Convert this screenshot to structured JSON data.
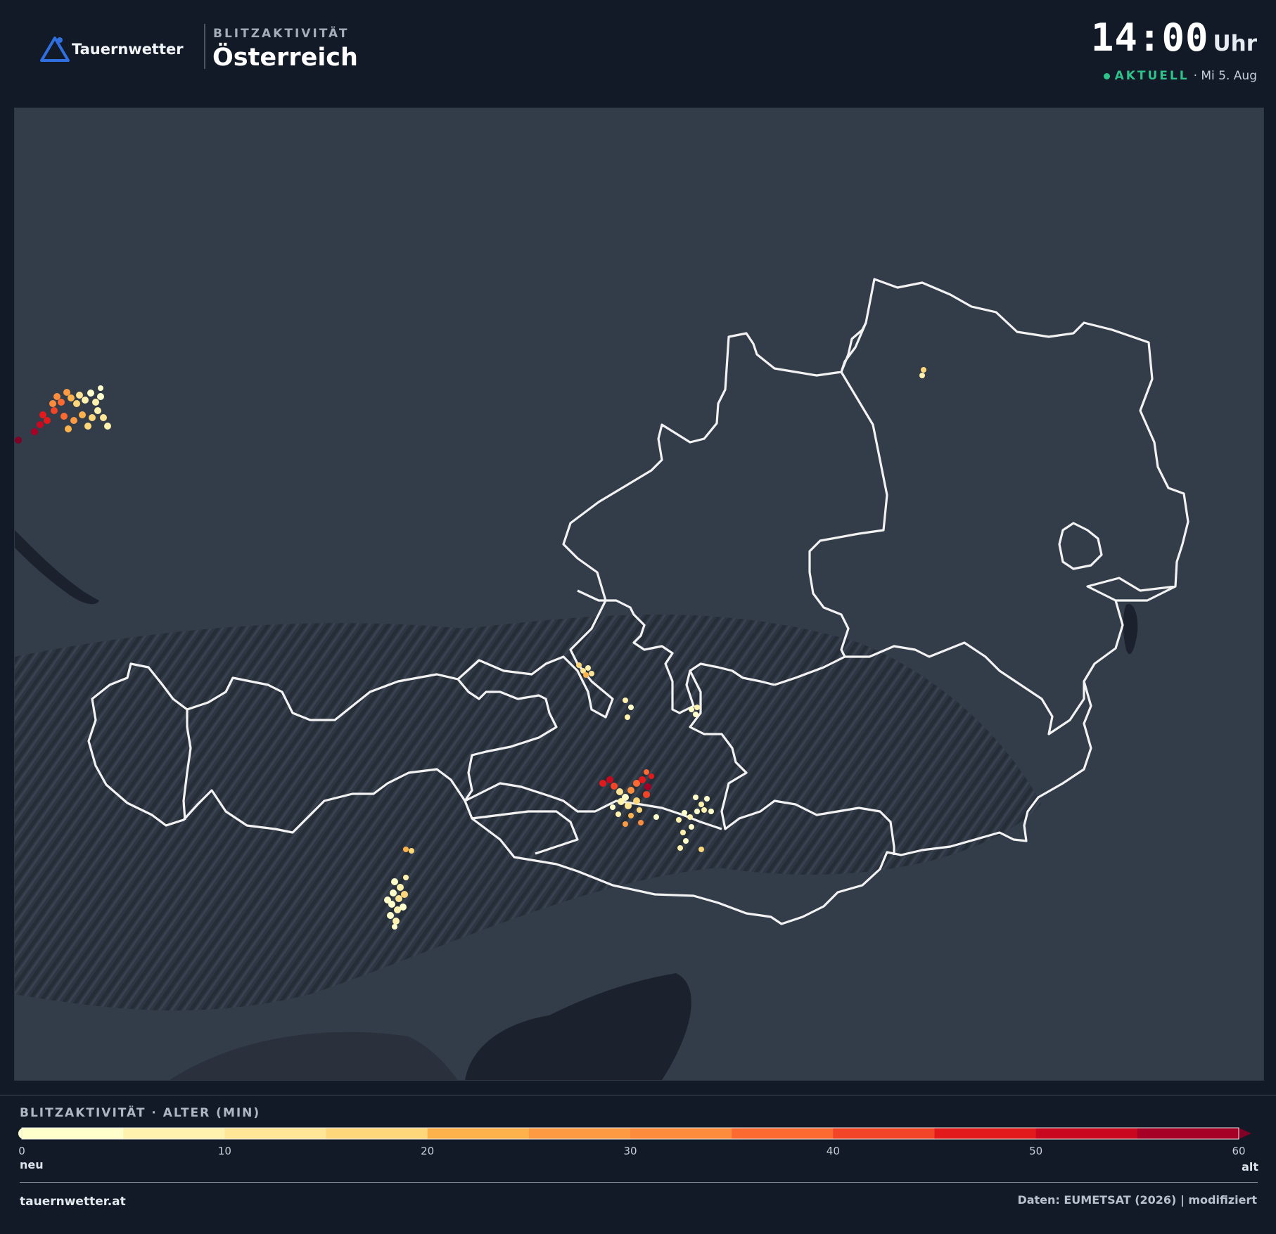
{
  "header": {
    "brand": "Tauernwetter",
    "kicker": "BLITZAKTIVITÄT",
    "region": "Österreich",
    "time": "14:00",
    "time_unit": "Uhr",
    "status": "AKTUELL",
    "date": "· Mi 5. Aug"
  },
  "map": {
    "icon": "austria-state-borders-map"
  },
  "legend": {
    "title": "BLITZAKTIVITÄT · ALTER (MIN)",
    "ticks": [
      "0",
      "10",
      "20",
      "30",
      "40",
      "50",
      "60"
    ],
    "label_new": "neu",
    "label_old": "alt",
    "colors": [
      "#ffffcc",
      "#fff2ae",
      "#ffe596",
      "#fed77a",
      "#feb24c",
      "#fd9a42",
      "#fd8d3c",
      "#fc6a32",
      "#f24527",
      "#e31a1c",
      "#c9081f",
      "#a70026",
      "#800026"
    ]
  },
  "footer": {
    "site": "tauernwetter.at",
    "credit": "Daten: EUMETSAT (2026) | modifiziert"
  },
  "colors": {
    "background": "#111a26",
    "accent_live": "#2ec38a",
    "border_lines": "#f2f2f2"
  }
}
